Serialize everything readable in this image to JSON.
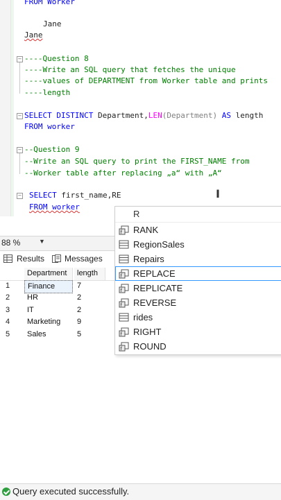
{
  "editor": {
    "lines": {
      "l1": "FROM Worker",
      "l2": "Jane",
      "l3": "Jane",
      "l4": "----Question 8",
      "l5": "----Write an SQL query that fetches the unique",
      "l6": "----values of DEPARTMENT from Worker table and prints",
      "l7": "----length",
      "l8_kw1": "SELECT DISTINCT",
      "l8_a": " Department,",
      "l8_fn": "LEN",
      "l8_b": "(Department) ",
      "l8_kw2": "AS",
      "l8_c": " length",
      "l9": "FROM worker",
      "l10": "--Question 9",
      "l11": "--Write an SQL query to print the FIRST_NAME from",
      "l12": "--Worker table after replacing „a“ with „A“",
      "l13_kw": "SELECT",
      "l13_rest": " first_name,RE",
      "l14": "FROM worker"
    }
  },
  "autocomplete": {
    "typed": "R",
    "items": [
      {
        "label": "RANK",
        "icon": "function-icon"
      },
      {
        "label": "RegionSales",
        "icon": "table-icon"
      },
      {
        "label": "Repairs",
        "icon": "table-icon"
      },
      {
        "label": "REPLACE",
        "icon": "function-icon",
        "selected": true
      },
      {
        "label": "REPLICATE",
        "icon": "function-icon"
      },
      {
        "label": "REVERSE",
        "icon": "function-icon"
      },
      {
        "label": "rides",
        "icon": "table-icon"
      },
      {
        "label": "RIGHT",
        "icon": "function-icon"
      },
      {
        "label": "ROUND",
        "icon": "function-icon"
      }
    ]
  },
  "zoom": {
    "value": "88 %"
  },
  "tabs": {
    "results": "Results",
    "messages": "Messages"
  },
  "grid": {
    "headers": [
      "Department",
      "length"
    ],
    "rows": [
      {
        "idx": "1",
        "department": "Finance",
        "length": "7"
      },
      {
        "idx": "2",
        "department": "HR",
        "length": "2"
      },
      {
        "idx": "3",
        "department": "IT",
        "length": "2"
      },
      {
        "idx": "4",
        "department": "Marketing",
        "length": "9"
      },
      {
        "idx": "5",
        "department": "Sales",
        "length": "5"
      }
    ]
  },
  "status": {
    "text": "Query executed successfully."
  },
  "colors": {
    "keyword": "#0000ff",
    "comment": "#008000",
    "function": "#ff00ff",
    "success": "#2e9e3e"
  }
}
